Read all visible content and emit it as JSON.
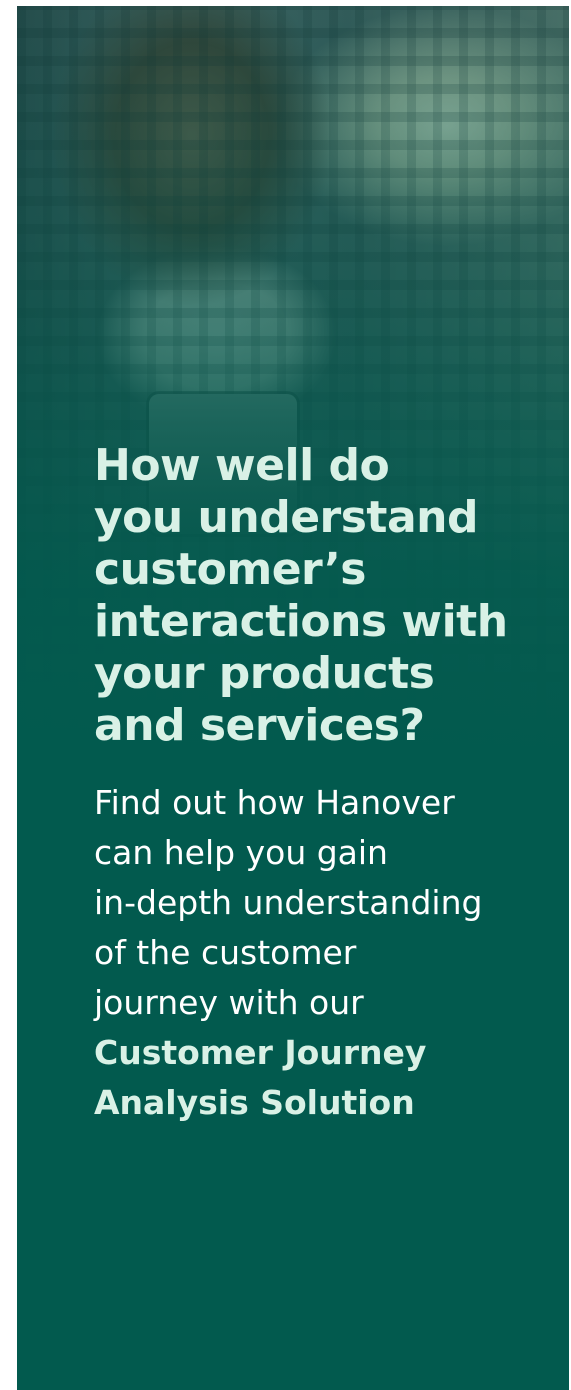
{
  "banner": {
    "headline": "How well do\nyou understand\ncustomer’s\ninteractions with\nyour products\nand services?",
    "body_text": "Find out how Hanover\ncan help you gain\nin-depth understanding\nof the customer\njourney with our",
    "highlight_text": "Customer Journey\nAnalysis Solution",
    "colors": {
      "background": "#025a4e",
      "headline": "#d9f1e6",
      "body": "#ffffff"
    }
  }
}
